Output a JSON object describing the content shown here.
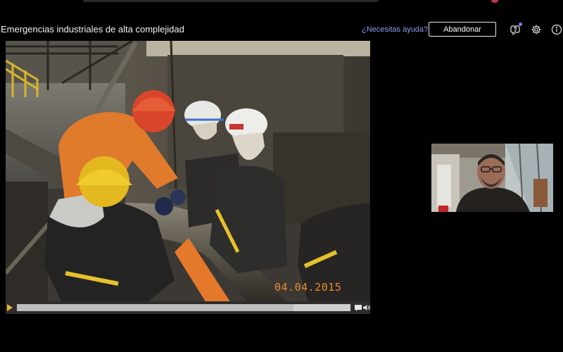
{
  "meeting": {
    "title": "Emergencias industriales de alta complejidad",
    "help_link": "¿Necesitas ayuda?",
    "leave_button": "Abandonar"
  },
  "header_icons": [
    "chat-help-icon",
    "gear-icon",
    "info-icon"
  ],
  "video": {
    "date_stamp": "04.04.2015",
    "progress": 0.83,
    "controls": [
      "play-icon",
      "captions-icon",
      "volume-icon"
    ]
  },
  "colors": {
    "background": "#000000",
    "link": "#8f9cf0",
    "play_accent": "#e5b52b",
    "date_stamp": "#e98a2a",
    "badge": "#7b83eb"
  }
}
